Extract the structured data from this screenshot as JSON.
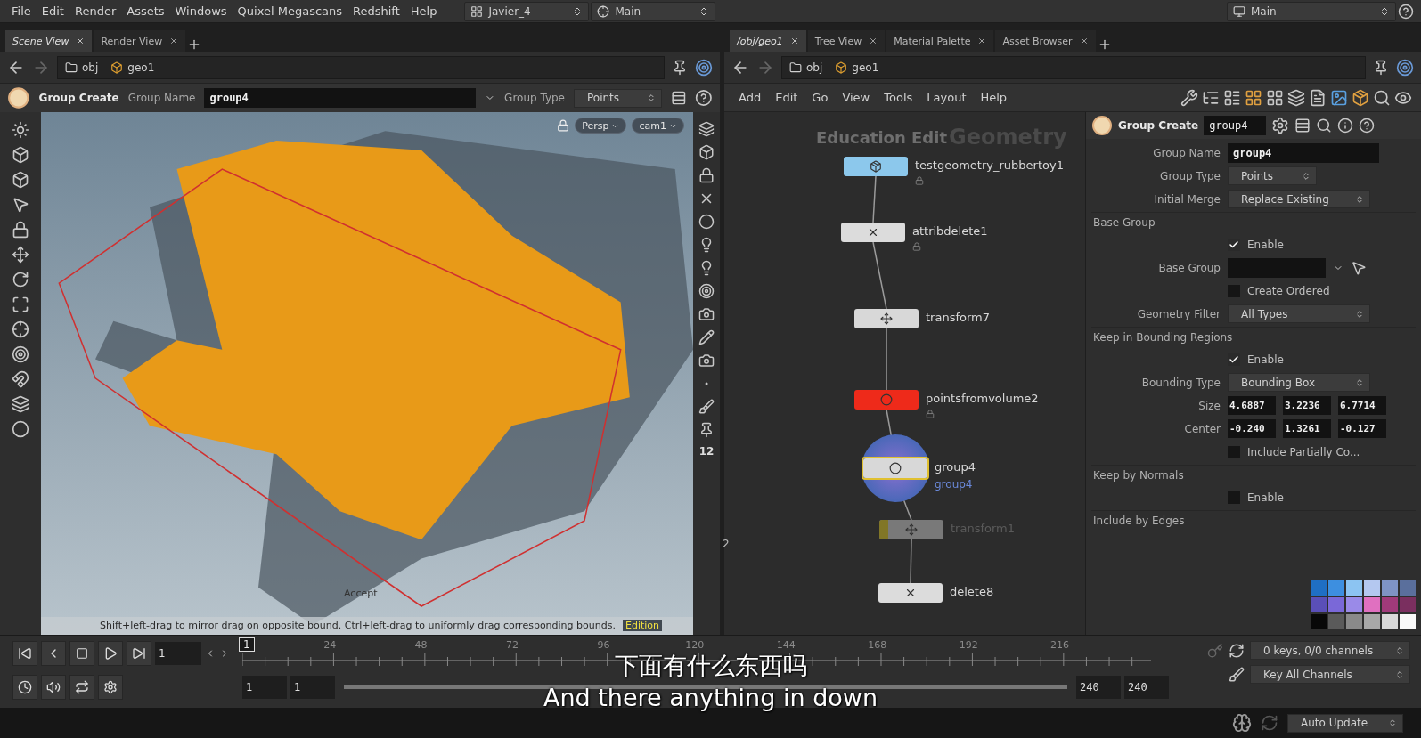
{
  "menu_bar": {
    "menus": [
      "File",
      "Edit",
      "Render",
      "Assets",
      "Windows",
      "Quixel Megascans",
      "Redshift",
      "Help"
    ],
    "desktop": "Javier_4",
    "context": "Main",
    "right_desktop": "Main"
  },
  "scene_pane": {
    "tabs": [
      {
        "label": "Scene View",
        "selected": true
      },
      {
        "label": "Render View",
        "selected": false
      }
    ],
    "path": [
      "obj",
      "geo1"
    ],
    "operator": {
      "name": "Group Create",
      "group_name_label": "Group Name",
      "group_name": "group4",
      "group_type_label": "Group Type",
      "group_type": "Points"
    },
    "viewport": {
      "camera": "Persp",
      "camera_menu": "cam1",
      "accept": "Accept",
      "hint": "Shift+left-drag to mirror drag on opposite bound. Ctrl+left-drag to uniformly drag corresponding bounds.",
      "edition": "Edition",
      "toolbar_number": "12"
    }
  },
  "network_pane": {
    "tabs": [
      {
        "label": "/obj/geo1",
        "selected": true
      },
      {
        "label": "Tree View",
        "selected": false
      },
      {
        "label": "Material Palette",
        "selected": false
      },
      {
        "label": "Asset Browser",
        "selected": false
      }
    ],
    "path": [
      "obj",
      "geo1"
    ],
    "menus": [
      "Add",
      "Edit",
      "Go",
      "View",
      "Tools",
      "Layout",
      "Help"
    ],
    "edition_mark": "Education Edit",
    "context": "Geometry",
    "side_number": "2",
    "nodes": [
      {
        "name": "testgeometry_rubbertoy1",
        "kind": "source",
        "selected": false,
        "bypassed": false,
        "locked": true
      },
      {
        "name": "attribdelete1",
        "kind": "attribute",
        "selected": false,
        "bypassed": false,
        "locked": true
      },
      {
        "name": "transform7",
        "kind": "transform",
        "selected": false,
        "bypassed": false,
        "locked": false
      },
      {
        "name": "pointsfromvolume2",
        "kind": "volume",
        "selected": false,
        "bypassed": false,
        "locked": true
      },
      {
        "name": "group4",
        "kind": "group",
        "selected": true,
        "bypassed": false,
        "locked": false,
        "comment": "group4"
      },
      {
        "name": "transform1",
        "kind": "transform",
        "selected": false,
        "bypassed": true,
        "locked": false
      },
      {
        "name": "delete8",
        "kind": "delete",
        "selected": false,
        "bypassed": false,
        "locked": false
      }
    ]
  },
  "parameters": {
    "node_type": "Group Create",
    "node_name": "group4",
    "rows": [
      {
        "kind": "text",
        "label": "Group Name",
        "value": "group4"
      },
      {
        "kind": "menu",
        "label": "Group Type",
        "value": "Points"
      },
      {
        "kind": "menu",
        "label": "Initial Merge",
        "value": "Replace Existing"
      },
      {
        "kind": "heading",
        "label": "Base Group"
      },
      {
        "kind": "toggle",
        "label": "Enable",
        "checked": true
      },
      {
        "kind": "picker",
        "label": "Base Group"
      },
      {
        "kind": "toggle",
        "label": "Create Ordered",
        "checked": false
      },
      {
        "kind": "menu",
        "label": "Geometry Filter",
        "value": "All Types"
      },
      {
        "kind": "heading",
        "label": "Keep in Bounding Regions"
      },
      {
        "kind": "toggle",
        "label": "Enable",
        "checked": true
      },
      {
        "kind": "menu",
        "label": "Bounding Type",
        "value": "Bounding Box"
      },
      {
        "kind": "vector",
        "label": "Size",
        "values": [
          "4.6887",
          "3.2236",
          "6.7714"
        ]
      },
      {
        "kind": "vector",
        "label": "Center",
        "values": [
          "-0.240",
          "1.3261",
          "-0.127"
        ]
      },
      {
        "kind": "toggle",
        "label": "Include Partially Co...",
        "checked": false
      },
      {
        "kind": "heading",
        "label": "Keep by Normals"
      },
      {
        "kind": "toggle",
        "label": "Enable",
        "checked": false
      },
      {
        "kind": "heading",
        "label": "Include by Edges"
      }
    ],
    "palette": [
      {
        "color": "#1f6fc4"
      },
      {
        "color": "#3d8fe0"
      },
      {
        "color": "#8cc4f2"
      },
      {
        "color": "#b4c8f0"
      },
      {
        "color": "#7f93c4"
      },
      {
        "color": "#5a6f9c"
      },
      {
        "color": "#5a4fb8"
      },
      {
        "color": "#7a68d8"
      },
      {
        "color": "#9a8ae8"
      },
      {
        "color": "#e070c0"
      },
      {
        "color": "#a03a7a"
      },
      {
        "color": "#7a2f5f"
      },
      {
        "color": "#080808"
      },
      {
        "color": "#5a5a5a"
      },
      {
        "color": "#8a8a8a"
      },
      {
        "color": "#a8a8a8"
      },
      {
        "color": "#d8d8d8"
      },
      {
        "color": "#f8f8f8"
      }
    ]
  },
  "timeline": {
    "current_frame": "1",
    "marker": "1",
    "ticks": [
      "24",
      "48",
      "72",
      "96",
      "120",
      "144",
      "168",
      "192",
      "216"
    ],
    "range_start": "1",
    "range_current": "1",
    "range_slider": {
      "level": 1
    },
    "range_end_current": "240",
    "range_end": "240",
    "keys": "0 keys, 0/0 channels",
    "key_mode": "Key All Channels"
  },
  "subtitles": {
    "chinese": "下面有什么东西吗",
    "english": "And there anything in down"
  },
  "status_bar": {
    "update_mode": "Auto Update"
  }
}
